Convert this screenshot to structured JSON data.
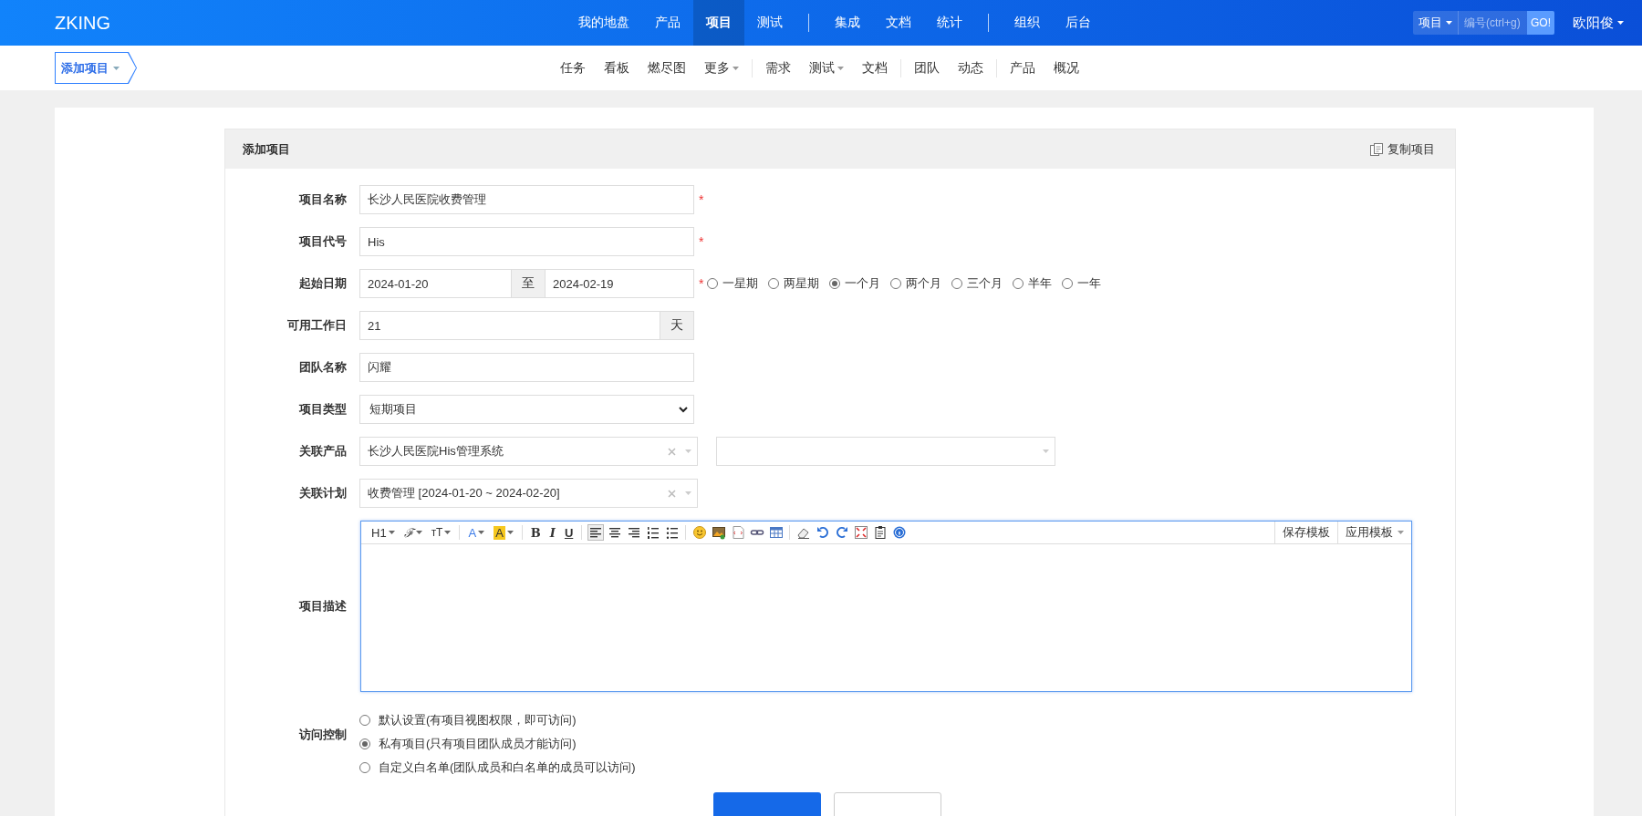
{
  "header": {
    "logo": "ZKING",
    "nav_groups": [
      [
        {
          "label": "我的地盘",
          "selected": false
        },
        {
          "label": "产品",
          "selected": false
        },
        {
          "label": "项目",
          "selected": true
        },
        {
          "label": "测试",
          "selected": false
        }
      ],
      [
        {
          "label": "集成",
          "selected": false
        },
        {
          "label": "文档",
          "selected": false
        },
        {
          "label": "统计",
          "selected": false
        }
      ],
      [
        {
          "label": "组织",
          "selected": false
        },
        {
          "label": "后台",
          "selected": false
        }
      ]
    ],
    "search": {
      "type": "项目",
      "placeholder": "编号(ctrl+g)",
      "button": "GO!"
    },
    "user": "欧阳俊"
  },
  "subnav": {
    "breadcrumb": "添加项目",
    "groups": [
      [
        {
          "label": "任务",
          "dropdown": false
        },
        {
          "label": "看板",
          "dropdown": false
        },
        {
          "label": "燃尽图",
          "dropdown": false
        },
        {
          "label": "更多",
          "dropdown": true
        }
      ],
      [
        {
          "label": "需求",
          "dropdown": false
        },
        {
          "label": "测试",
          "dropdown": true
        },
        {
          "label": "文档",
          "dropdown": false
        }
      ],
      [
        {
          "label": "团队",
          "dropdown": false
        },
        {
          "label": "动态",
          "dropdown": false
        }
      ],
      [
        {
          "label": "产品",
          "dropdown": false
        },
        {
          "label": "概况",
          "dropdown": false
        }
      ]
    ]
  },
  "panel": {
    "title": "添加项目",
    "copy_action": "复制项目"
  },
  "fields": [
    {
      "kind": "text",
      "label": "项目名称",
      "value": "长沙人民医院收费管理",
      "required_mark": "*"
    },
    {
      "kind": "text",
      "label": "项目代号",
      "value": "His",
      "required_mark": "*"
    },
    {
      "kind": "daterange",
      "label": "起始日期",
      "begin": "2024-01-20",
      "separator": "至",
      "end": "2024-02-19",
      "required_mark": "*",
      "presets": [
        {
          "label": "一星期",
          "selected": false
        },
        {
          "label": "两星期",
          "selected": false
        },
        {
          "label": "一个月",
          "selected": true
        },
        {
          "label": "两个月",
          "selected": false
        },
        {
          "label": "三个月",
          "selected": false
        },
        {
          "label": "半年",
          "selected": false
        },
        {
          "label": "一年",
          "selected": false
        }
      ]
    },
    {
      "kind": "addon",
      "label": "可用工作日",
      "value": "21",
      "unit": "天"
    },
    {
      "kind": "text",
      "label": "团队名称",
      "value": "闪耀"
    },
    {
      "kind": "select",
      "label": "项目类型",
      "value": "短期项目"
    },
    {
      "kind": "picker",
      "label": "关联产品",
      "pickers": [
        {
          "value": "长沙人民医院His管理系统",
          "clearable": true
        },
        {
          "clearable": false
        }
      ]
    },
    {
      "kind": "picker",
      "label": "关联计划",
      "pickers": [
        {
          "value": "收费管理 [2024-01-20 ~ 2024-02-20]",
          "clearable": true
        }
      ]
    },
    {
      "kind": "editor",
      "label": "项目描述",
      "toolbar": [
        {
          "kind": "heading",
          "label": "H1",
          "dropdown": true
        },
        {
          "kind": "font",
          "label": "ℱ",
          "dropdown": true
        },
        {
          "kind": "size",
          "label": "ᴛT",
          "dropdown": true
        },
        {
          "kind": "color",
          "label": "A",
          "dropdown": true
        },
        {
          "kind": "highlight",
          "label": "A",
          "dropdown": true
        },
        {
          "kind": "bold",
          "label": "B",
          "dropdown": false
        },
        {
          "kind": "italic",
          "label": "I",
          "dropdown": false
        },
        {
          "kind": "underline",
          "label": "U",
          "dropdown": false
        }
      ],
      "alignments": [
        {
          "selected": true
        },
        {
          "selected": false
        },
        {
          "selected": false
        }
      ],
      "templates": [
        {
          "label": "保存模板",
          "dropdown": false
        },
        {
          "label": "应用模板",
          "dropdown": true
        }
      ]
    },
    {
      "kind": "radios",
      "label": "访问控制",
      "options": [
        {
          "label": "默认设置(有项目视图权限，即可访问)",
          "selected": false
        },
        {
          "label": "私有项目(只有项目团队成员才能访问)",
          "selected": true
        },
        {
          "label": "自定义白名单(团队成员和白名单的成员可以访问)",
          "selected": false
        }
      ]
    }
  ],
  "buttons": [
    {
      "kind": "primary"
    },
    {
      "kind": "default"
    }
  ]
}
